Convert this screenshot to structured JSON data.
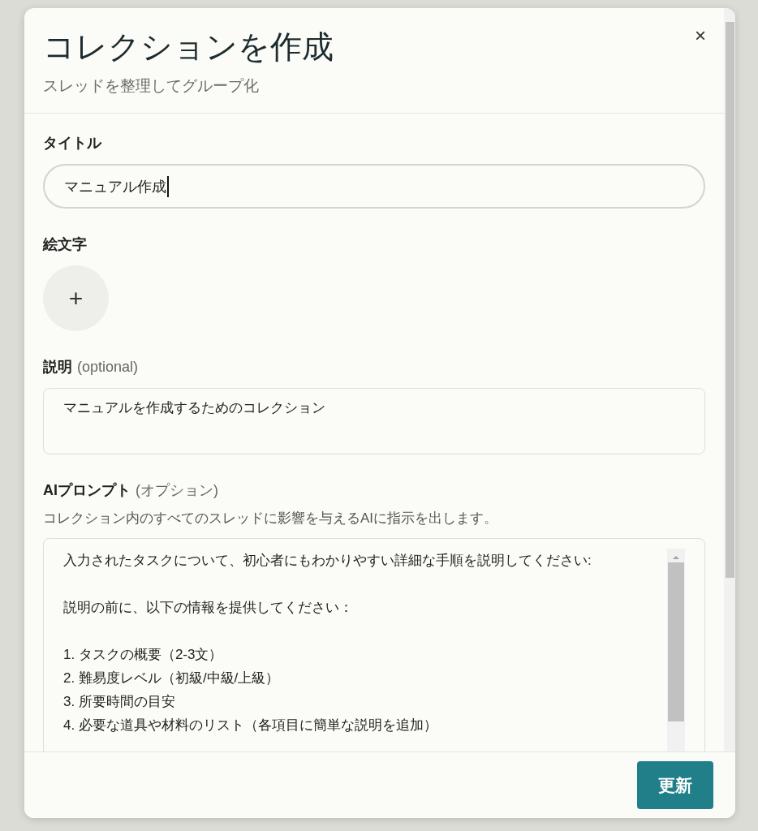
{
  "dialog": {
    "title": "コレクションを作成",
    "subtitle": "スレッドを整理してグループ化",
    "close": "×"
  },
  "fields": [
    {
      "kind": "text",
      "label": "タイトル",
      "value": "マニュアル作成",
      "focused": true
    },
    {
      "kind": "emoji",
      "label": "絵文字",
      "button": "+"
    },
    {
      "kind": "textarea",
      "label": "説明",
      "note": "(optional)",
      "value": "マニュアルを作成するためのコレクション"
    },
    {
      "kind": "prompt",
      "label": "AIプロンプト",
      "note": "(オプション)",
      "hint": "コレクション内のすべてのスレッドに影響を与えるAIに指示を出します。",
      "value": "入力されたタスクについて、初心者にもわかりやすい詳細な手順を説明してください:\n\n説明の前に、以下の情報を提供してください：\n\n1. タスクの概要（2-3文）\n2. 難易度レベル（初級/中級/上級）\n3. 所要時間の目安\n4. 必要な道具や材料のリスト（各項目に簡単な説明を追加）"
    }
  ],
  "footer": {
    "button": "更新"
  }
}
